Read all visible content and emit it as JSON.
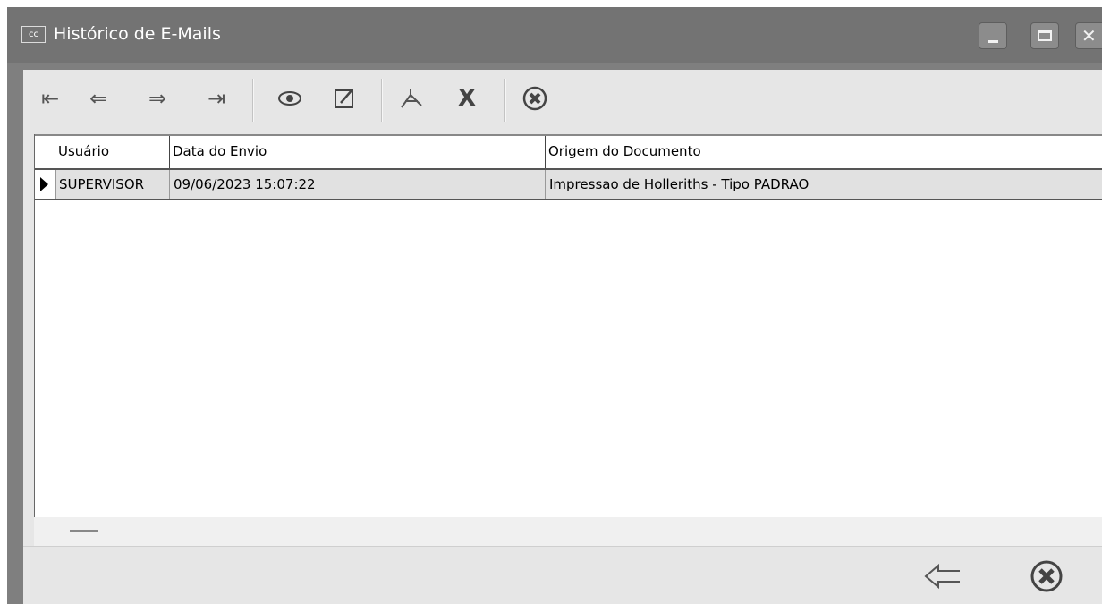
{
  "window": {
    "icon_text": "cc",
    "title": "Histórico de E-Mails",
    "controls": [
      "minimize-icon",
      "maximize-icon",
      "close-icon"
    ]
  },
  "toolbar": {
    "buttons": [
      {
        "name": "first-record-button",
        "icon": "first-icon",
        "glyph": "⇤"
      },
      {
        "name": "previous-record-button",
        "icon": "previous-icon",
        "glyph": "⇐"
      },
      {
        "name": "next-record-button",
        "icon": "next-icon",
        "glyph": "⇒"
      },
      {
        "name": "last-record-button",
        "icon": "last-icon",
        "glyph": "⇥"
      },
      {
        "name": "view-button",
        "icon": "eye-icon",
        "glyph": "◎"
      },
      {
        "name": "edit-button",
        "icon": "edit-icon",
        "glyph": "✎"
      },
      {
        "name": "pdf-button",
        "icon": "acrobat-icon",
        "glyph": "⅄"
      },
      {
        "name": "excel-button",
        "icon": "excel-icon",
        "glyph": "X"
      },
      {
        "name": "cancel-button",
        "icon": "cancel-circle-icon",
        "glyph": "✖"
      }
    ]
  },
  "grid": {
    "columns": [
      "Usuário",
      "Data do Envio",
      "Origem do Documento"
    ],
    "rows": [
      {
        "usuario": "SUPERVISOR",
        "data": "09/06/2023 15:07:22",
        "origem": "Impressao de Holleriths - Tipo PADRAO"
      }
    ]
  },
  "bottom": {
    "buttons": [
      {
        "name": "back-button",
        "icon": "back-arrow-icon"
      },
      {
        "name": "close-button",
        "icon": "cancel-circle-icon"
      }
    ]
  }
}
